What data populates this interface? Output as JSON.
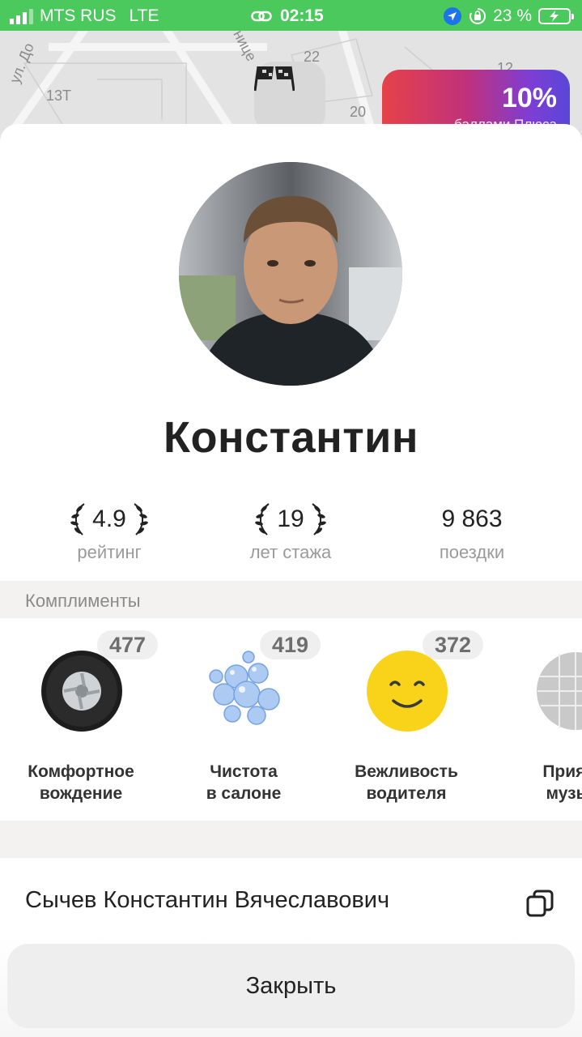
{
  "status_bar": {
    "carrier": "MTS RUS",
    "network": "LTE",
    "time": "02:15",
    "battery": "23 %"
  },
  "map": {
    "street_label": "ул. До",
    "street_label_2": "ницe",
    "house_labels": [
      "13Т",
      "22",
      "20",
      "12"
    ],
    "promo": {
      "value": "10%",
      "subtitle": "баллами Плюса"
    }
  },
  "driver": {
    "name": "Константин",
    "full_name": "Сычев Константин Вячеславович"
  },
  "stats": [
    {
      "value": "4.9",
      "label": "рейтинг",
      "laurel": true
    },
    {
      "value": "19",
      "label": "лет стажа",
      "laurel": true
    },
    {
      "value": "9 863",
      "label": "поездки",
      "laurel": false
    }
  ],
  "compliments": {
    "title": "Комплименты",
    "items": [
      {
        "count": "477",
        "label_line1": "Комфортное",
        "label_line2": "вождение",
        "icon": "wheel-icon"
      },
      {
        "count": "419",
        "label_line1": "Чистота",
        "label_line2": "в салоне",
        "icon": "bubbles-icon"
      },
      {
        "count": "372",
        "label_line1": "Вежливость",
        "label_line2": "водителя",
        "icon": "smiley-icon"
      },
      {
        "count": "",
        "label_line1": "Прият",
        "label_line2": "музы",
        "icon": "disco-ball-icon"
      }
    ]
  },
  "actions": {
    "close_label": "Закрыть"
  },
  "colors": {
    "status_bar": "#4bc95c",
    "sheet": "#ffffff",
    "section_bg": "#f3f2f0",
    "muted_text": "#9a9a9a",
    "smiley": "#f9d21a"
  }
}
